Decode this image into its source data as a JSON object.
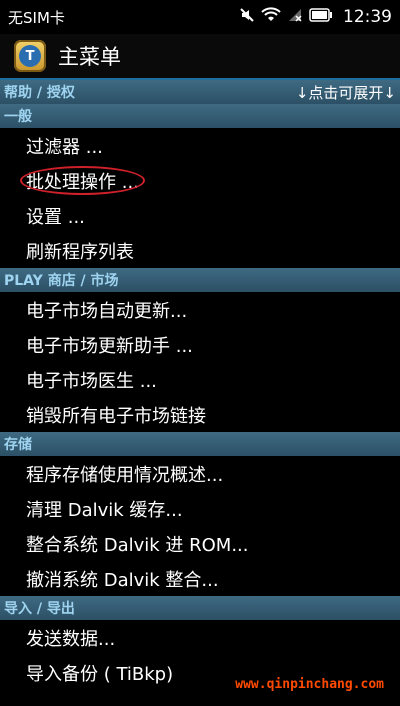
{
  "status_bar": {
    "carrier": "无SIM卡",
    "time": "12:39",
    "icons": [
      "mute-icon",
      "wifi-icon",
      "signal-icon",
      "battery-icon"
    ]
  },
  "action_bar": {
    "title": "主菜单",
    "app_icon": "titanium-backup-icon",
    "app_icon_letter": "T"
  },
  "sections": {
    "help": {
      "label": "帮助 / 授权",
      "right_label": "↓点击可展开↓"
    },
    "general": {
      "label": "一般",
      "items": [
        "过滤器 ...",
        "批处理操作 ...",
        "设置 ...",
        "刷新程序列表"
      ]
    },
    "play": {
      "label": "PLAY 商店 / 市场",
      "items": [
        "电子市场自动更新...",
        "电子市场更新助手 ...",
        "电子市场医生 ...",
        "销毁所有电子市场链接"
      ]
    },
    "storage": {
      "label": "存储",
      "items": [
        "程序存储使用情况概述...",
        "清理 Dalvik 缓存...",
        "整合系统 Dalvik 进 ROM...",
        "撤消系统 Dalvik 整合..."
      ]
    },
    "import_export": {
      "label": "导入 / 导出",
      "items": [
        "发送数据...",
        "导入备份 ( TiBkp)"
      ]
    }
  },
  "watermark": "www.qinpinchang.com",
  "colors": {
    "section_bg": "#36607a",
    "section_text": "#9fd4f0",
    "highlight_oval": "#d0202a"
  }
}
